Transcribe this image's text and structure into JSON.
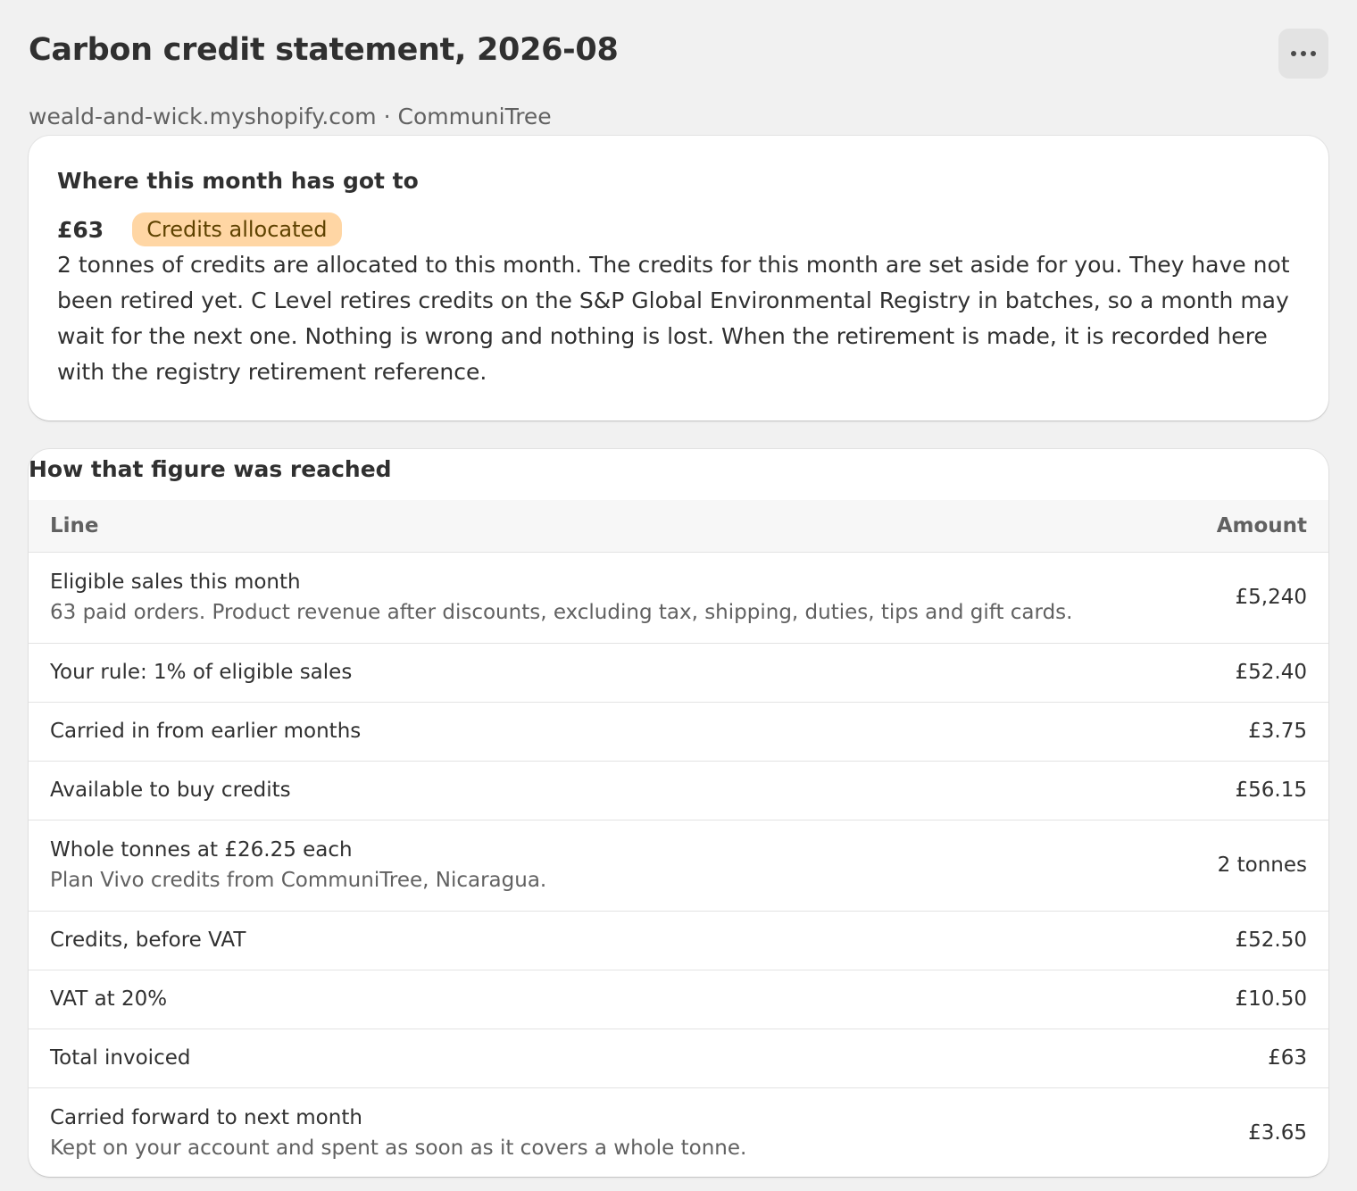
{
  "header": {
    "title": "Carbon credit statement, 2026-08",
    "subtitle": "weald-and-wick.myshopify.com · CommuniTree",
    "more_icon": "more-horizontal-icon"
  },
  "status": {
    "heading": "Where this month has got to",
    "amount": "£63",
    "badge": "Credits allocated",
    "badge_color": "#ffd6a4",
    "text": "2 tonnes of credits are allocated to this month. The credits for this month are set aside for you. They have not been retired yet. C Level retires credits on the S&P Global Environmental Registry in batches, so a month may wait for the next one. Nothing is wrong and nothing is lost. When the retirement is made, it is recorded here with the registry retirement reference."
  },
  "breakdown": {
    "heading": "How that figure was reached",
    "columns": {
      "line": "Line",
      "amount": "Amount"
    },
    "rows": [
      {
        "label": "Eligible sales this month",
        "detail": "63 paid orders. Product revenue after discounts, excluding tax, shipping, duties, tips and gift cards.",
        "amount": "£5,240"
      },
      {
        "label": "Your rule: 1% of eligible sales",
        "detail": "",
        "amount": "£52.40"
      },
      {
        "label": "Carried in from earlier months",
        "detail": "",
        "amount": "£3.75"
      },
      {
        "label": "Available to buy credits",
        "detail": "",
        "amount": "£56.15"
      },
      {
        "label": "Whole tonnes at £26.25 each",
        "detail": "Plan Vivo credits from CommuniTree, Nicaragua.",
        "amount": "2 tonnes"
      },
      {
        "label": "Credits, before VAT",
        "detail": "",
        "amount": "£52.50"
      },
      {
        "label": "VAT at 20%",
        "detail": "",
        "amount": "£10.50"
      },
      {
        "label": "Total invoiced",
        "detail": "",
        "amount": "£63"
      },
      {
        "label": "Carried forward to next month",
        "detail": "Kept on your account and spent as soon as it covers a whole tonne.",
        "amount": "£3.65"
      }
    ]
  }
}
